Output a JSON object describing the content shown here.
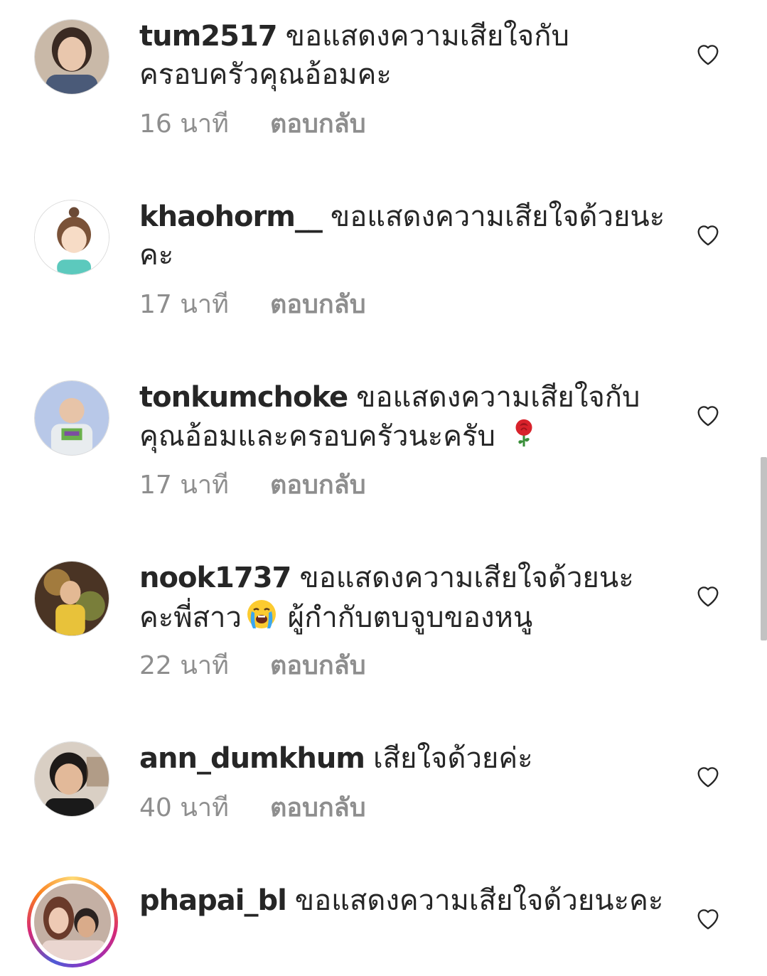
{
  "comments": [
    {
      "username": "tum2517",
      "text": "ขอแสดงความเสียใจกับครอบครัวคุณอ้อมคะ",
      "time": "16 นาที",
      "reply": "ตอบกลับ"
    },
    {
      "username": "khaohorm__",
      "text": "ขอแสดงความเสียใจด้วยนะคะ",
      "time": "17 นาที",
      "reply": "ตอบกลับ"
    },
    {
      "username": "tonkumchoke",
      "text": "ขอแสดงความเสียใจกับคุณอ้อมและครอบครัวนะครับ",
      "emoji": "rose",
      "time": "17 นาที",
      "reply": "ตอบกลับ"
    },
    {
      "username": "nook1737",
      "text": "ขอแสดงความเสียใจด้วยนะคะพี่สาว",
      "emoji": "loudly-crying-face",
      "text2": " ผู้กำกับตบจูบของหนู",
      "time": "22 นาที",
      "reply": "ตอบกลับ"
    },
    {
      "username": "ann_dumkhum",
      "text": "เสียใจด้วยค่ะ",
      "time": "40 นาที",
      "reply": "ตอบกลับ"
    },
    {
      "username": "phapai_bl",
      "text": "ขอแสดงความเสียใจด้วยนะคะ",
      "story_ring": true
    }
  ],
  "icons": {
    "like": "heart-outline-icon"
  },
  "colors": {
    "text": "#262626",
    "secondary": "#8e8e8e",
    "background": "#ffffff"
  }
}
